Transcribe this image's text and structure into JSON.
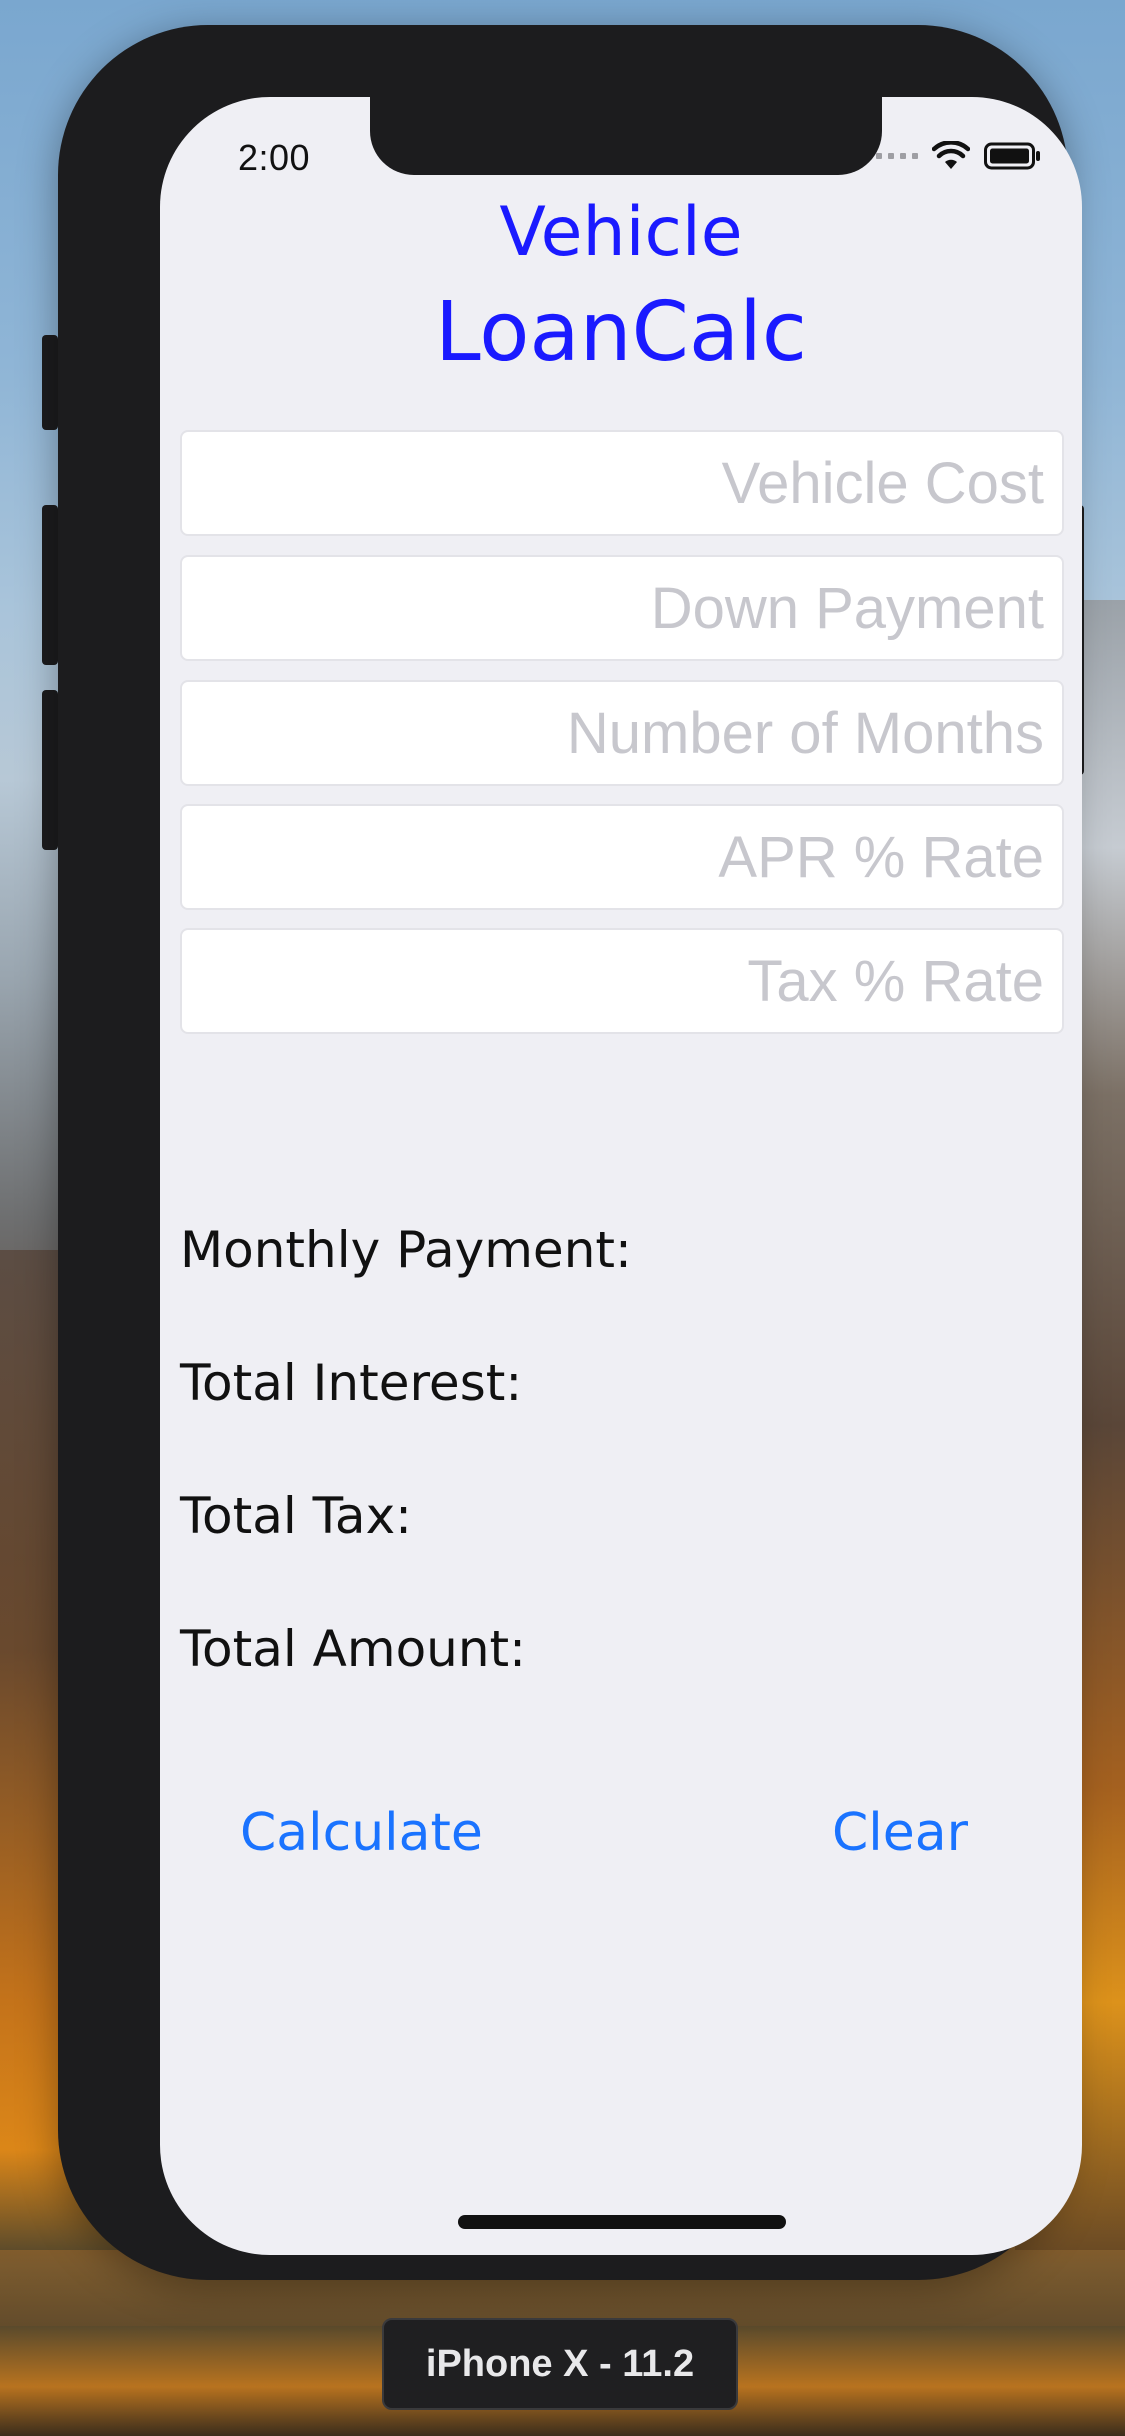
{
  "status_bar": {
    "time": "2:00",
    "wifi_icon": "wifi-icon",
    "battery_icon": "battery-icon"
  },
  "app": {
    "title_line1": "Vehicle",
    "title_line2": "LoanCalc",
    "title_color": "#1a1aff"
  },
  "inputs": [
    {
      "placeholder": "Vehicle Cost",
      "value": ""
    },
    {
      "placeholder": "Down Payment",
      "value": ""
    },
    {
      "placeholder": "Number of Months",
      "value": ""
    },
    {
      "placeholder": "APR % Rate",
      "value": ""
    },
    {
      "placeholder": "Tax % Rate",
      "value": ""
    }
  ],
  "results": {
    "monthly_payment": "Monthly Payment:",
    "total_interest": "Total Interest:",
    "total_tax": "Total Tax:",
    "total_amount": "Total Amount:"
  },
  "actions": {
    "calculate": "Calculate",
    "clear": "Clear",
    "color": "#1a73ff"
  },
  "simulator": {
    "label": "iPhone X - 11.2"
  }
}
